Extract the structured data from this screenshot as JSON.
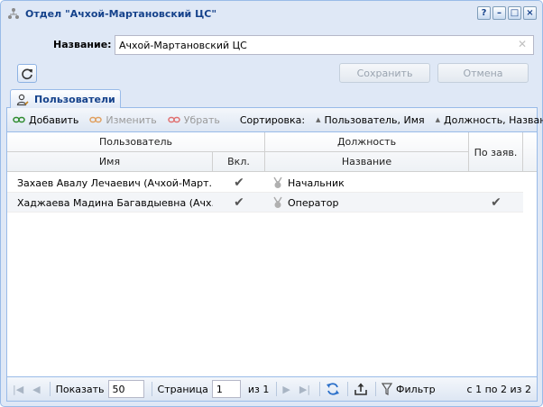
{
  "window": {
    "title": "Отдел \"Ачхой-Мартановский ЦС\"",
    "tools": [
      "?",
      "–",
      "□",
      "×"
    ]
  },
  "form": {
    "name_label": "Название:",
    "name_value": "Ачхой-Мартановский ЦС",
    "save_label": "Сохранить",
    "cancel_label": "Отмена"
  },
  "tabs": [
    {
      "label": "Пользователи",
      "active": true
    }
  ],
  "toolbar": {
    "add_label": "Добавить",
    "edit_label": "Изменить",
    "remove_label": "Убрать",
    "sort_label": "Сортировка:",
    "sort1_label": "Пользователь, Имя",
    "sort2_label": "Должность, Название"
  },
  "grid": {
    "group_user": "Пользователь",
    "group_position": "Должность",
    "col_name": "Имя",
    "col_enabled": "Вкл.",
    "col_title": "Название",
    "col_by_request": "По заяв.",
    "rows": [
      {
        "name": "Захаев Авалу Лечаевич (Ачхой-Март...",
        "enabled": true,
        "title": "Начальник",
        "by_request": false
      },
      {
        "name": "Хаджаева Мадина Багавдыевна (Ачх...",
        "enabled": true,
        "title": "Оператор",
        "by_request": true
      }
    ]
  },
  "pager": {
    "show_label": "Показать",
    "page_size": "50",
    "page_label": "Страница",
    "page_value": "1",
    "of_label": "из 1",
    "filter_label": "Фильтр",
    "info": "с 1 по 2 из 2"
  },
  "colors": {
    "accent": "#15428b",
    "frame": "#99bbe8",
    "background": "#dfe8f6"
  }
}
